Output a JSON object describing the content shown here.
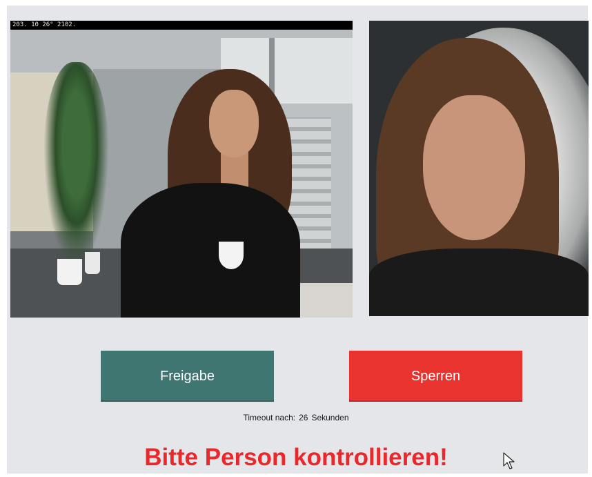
{
  "camera": {
    "timestamp": "203. 10 26° 2102.",
    "icon": "camera-feed"
  },
  "reference": {
    "icon": "reference-photo"
  },
  "actions": {
    "approve_label": "Freigabe",
    "lock_label": "Sperren"
  },
  "timeout": {
    "label": "Timeout nach:",
    "seconds": "26",
    "unit": "Sekunden"
  },
  "prompt": "Bitte Person kontrollieren!",
  "colors": {
    "panel_bg": "#e4e6ea",
    "approve": "#3f7671",
    "lock": "#e8332f",
    "prompt": "#e8282b"
  }
}
